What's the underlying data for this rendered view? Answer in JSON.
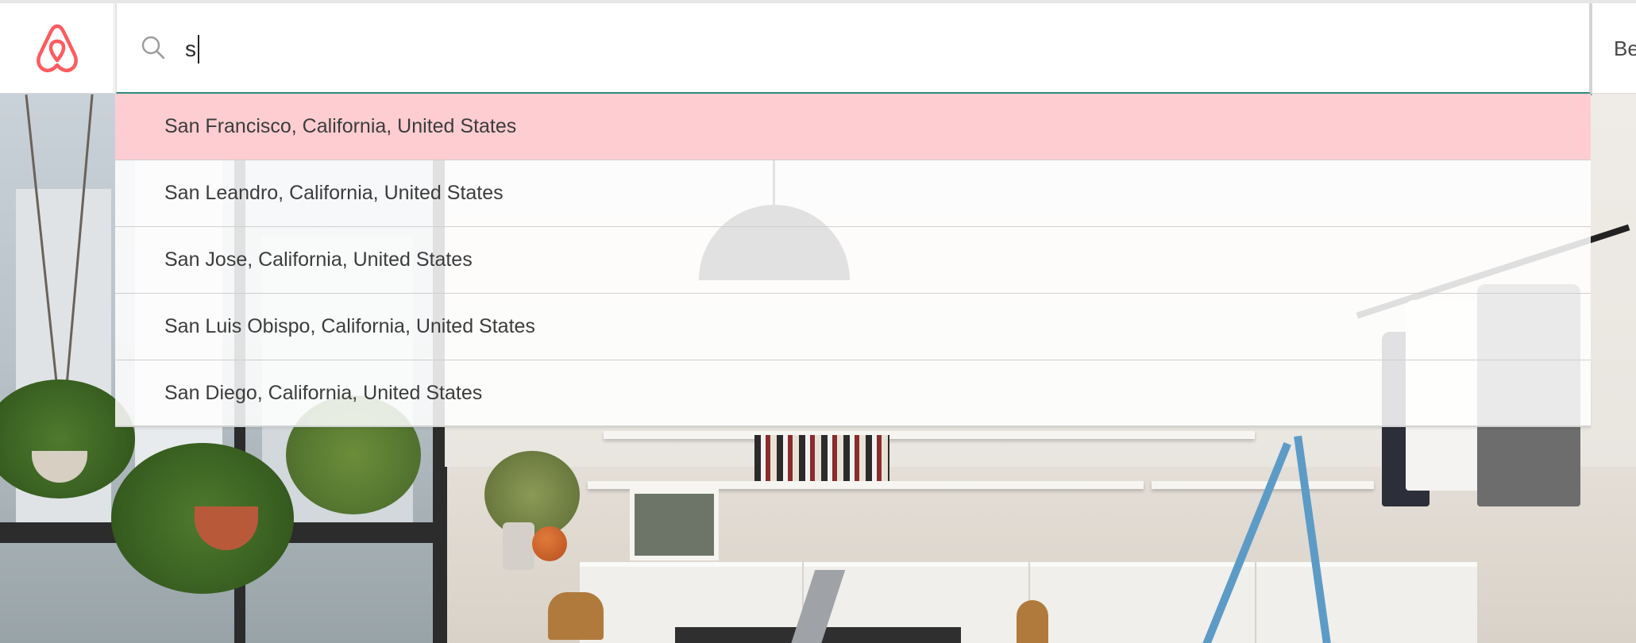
{
  "header": {
    "logo_icon": "airbnb-belo-icon",
    "brand_color": "#FF5A5F",
    "nav_right_partial": "Be"
  },
  "search": {
    "icon": "search-icon",
    "value": "s",
    "focus_underline_color": "#2E8A7E"
  },
  "suggestions": {
    "highlight_color": "#FDCDD1",
    "items": [
      {
        "label": "San Francisco, California, United States",
        "active": true
      },
      {
        "label": "San Leandro, California, United States",
        "active": false
      },
      {
        "label": "San Jose, California, United States",
        "active": false
      },
      {
        "label": "San Luis Obispo, California, United States",
        "active": false
      },
      {
        "label": "San Diego, California, United States",
        "active": false
      }
    ]
  }
}
